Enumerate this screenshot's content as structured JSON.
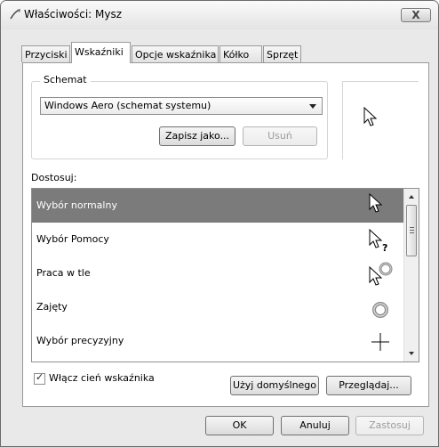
{
  "window": {
    "title": "Właściwości: Mysz",
    "close_glyph": "X"
  },
  "tabs": [
    {
      "label": "Przyciski",
      "active": false
    },
    {
      "label": "Wskaźniki",
      "active": true
    },
    {
      "label": "Opcje wskaźnika",
      "active": false
    },
    {
      "label": "Kółko",
      "active": false
    },
    {
      "label": "Sprzęt",
      "active": false
    }
  ],
  "scheme": {
    "group_label": "Schemat",
    "selected": "Windows Aero (schemat systemu)",
    "save_as_label": "Zapisz jako...",
    "delete_label": "Usuń"
  },
  "preview_icon": "arrow-pointer-icon",
  "customize": {
    "label": "Dostosuj:",
    "items": [
      {
        "label": "Wybór normalny",
        "icon": "arrow-pointer-icon",
        "selected": true
      },
      {
        "label": "Wybór Pomocy",
        "icon": "help-pointer-icon",
        "selected": false
      },
      {
        "label": "Praca w tle",
        "icon": "working-in-background-icon",
        "selected": false
      },
      {
        "label": "Zajęty",
        "icon": "busy-ring-icon",
        "selected": false
      },
      {
        "label": "Wybór precyzyjny",
        "icon": "crosshair-icon",
        "selected": false
      }
    ]
  },
  "shadow": {
    "label": "Włącz cień wskaźnika",
    "checked": true,
    "check_glyph": "✓"
  },
  "buttons": {
    "use_default": "Użyj domyślnego",
    "browse": "Przeglądaj...",
    "ok": "OK",
    "cancel": "Anuluj",
    "apply": "Zastosuj"
  },
  "colors": {
    "selected_row": "#7b7b7b",
    "dialog_bg": "#e9e9e9"
  }
}
